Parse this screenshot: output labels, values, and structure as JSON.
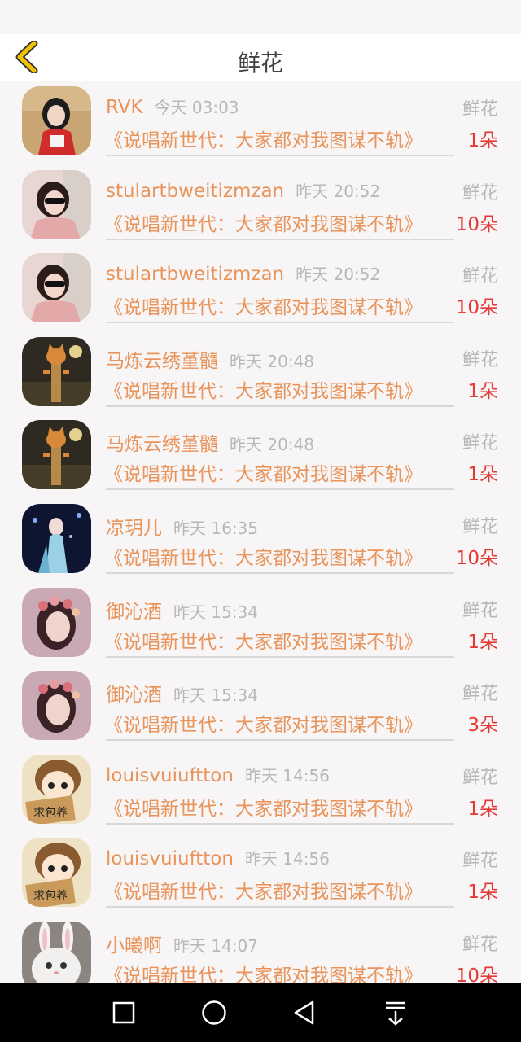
{
  "header": {
    "title": "鲜花"
  },
  "colors": {
    "accent": "#e8945a",
    "count": "#e53935",
    "back": "#f2c200"
  },
  "gifts": [
    {
      "name": "RVK",
      "time": "今天 03:03",
      "type": "鲜花",
      "work": "《说唱新世代：大家都对我图谋不轨》",
      "count": "1朵",
      "avatar": "girl-red"
    },
    {
      "name": "stulartbweitizmzan",
      "time": "昨天 20:52",
      "type": "鲜花",
      "work": "《说唱新世代：大家都对我图谋不轨》",
      "count": "10朵",
      "avatar": "girl-sunglasses"
    },
    {
      "name": "stulartbweitizmzan",
      "time": "昨天 20:52",
      "type": "鲜花",
      "work": "《说唱新世代：大家都对我图谋不轨》",
      "count": "10朵",
      "avatar": "girl-sunglasses"
    },
    {
      "name": "马炼云绣堇髓",
      "time": "昨天 20:48",
      "type": "鲜花",
      "work": "《说唱新世代：大家都对我图谋不轨》",
      "count": "1朵",
      "avatar": "cat-post"
    },
    {
      "name": "马炼云绣堇髓",
      "time": "昨天 20:48",
      "type": "鲜花",
      "work": "《说唱新世代：大家都对我图谋不轨》",
      "count": "1朵",
      "avatar": "cat-post"
    },
    {
      "name": "凉玥儿",
      "time": "昨天 16:35",
      "type": "鲜花",
      "work": "《说唱新世代：大家都对我图谋不轨》",
      "count": "10朵",
      "avatar": "girl-stage"
    },
    {
      "name": "御沁酒",
      "time": "昨天 15:34",
      "type": "鲜花",
      "work": "《说唱新世代：大家都对我图谋不轨》",
      "count": "1朵",
      "avatar": "girl-flowers"
    },
    {
      "name": "御沁酒",
      "time": "昨天 15:34",
      "type": "鲜花",
      "work": "《说唱新世代：大家都对我图谋不轨》",
      "count": "3朵",
      "avatar": "girl-flowers"
    },
    {
      "name": "louisvuiuftton",
      "time": "昨天 14:56",
      "type": "鲜花",
      "work": "《说唱新世代：大家都对我图谋不轨》",
      "count": "1朵",
      "avatar": "cartoon-sign"
    },
    {
      "name": "louisvuiuftton",
      "time": "昨天 14:56",
      "type": "鲜花",
      "work": "《说唱新世代：大家都对我图谋不轨》",
      "count": "1朵",
      "avatar": "cartoon-sign"
    },
    {
      "name": "小曦啊",
      "time": "昨天 14:07",
      "type": "鲜花",
      "work": "《说唱新世代：大家都对我图谋不轨》",
      "count": "10朵",
      "avatar": "bunny-cat"
    }
  ],
  "nav": {
    "recent": "recent-apps-icon",
    "home": "home-icon",
    "back": "back-triangle-icon",
    "notifications": "pull-down-icon"
  }
}
